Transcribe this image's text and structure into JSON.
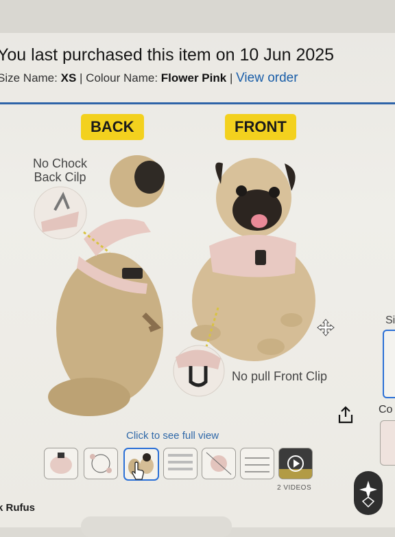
{
  "purchase": {
    "line": "You last purchased this item on 10 Jun 2025",
    "size_label": "Size Name:",
    "size_value": "XS",
    "colour_label": "Colour Name:",
    "colour_value": "Flower Pink",
    "view_order": "View order"
  },
  "gallery": {
    "back_label": "BACK",
    "front_label": "FRONT",
    "back_clip": "No Chock\nBack Cilp",
    "front_clip": "No pull Front Clip",
    "zoom_hint": "Click to see full view",
    "thumbnails": 7,
    "selected_index": 2,
    "videos_label": "2 VIDEOS"
  },
  "right_panel": {
    "size_heading": "Si",
    "colour_heading": "Co"
  },
  "footer": {
    "store_fragment": "k Rufus"
  },
  "colors": {
    "link": "#1a5ea8",
    "accent_rule": "#2e63a8",
    "tag_yellow": "#f3d11e",
    "selection_blue": "#2a6fd6",
    "harness_pink": "#e8c9c2"
  }
}
